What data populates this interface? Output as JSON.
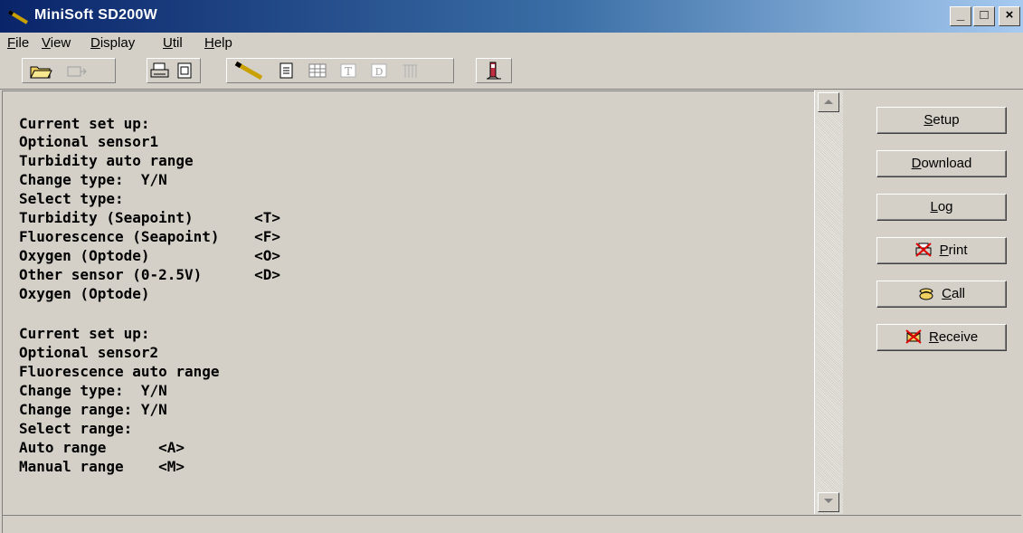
{
  "window": {
    "title": "MiniSoft SD200W",
    "controls": [
      "_",
      "□",
      "×"
    ]
  },
  "menu": [
    {
      "accel": "F",
      "rest": "ile"
    },
    {
      "accel": "V",
      "rest": "iew"
    },
    {
      "accel": "D",
      "rest": "isplay"
    },
    {
      "accel": "U",
      "rest": "til"
    },
    {
      "accel": "H",
      "rest": "elp"
    }
  ],
  "toolbar_icons": [
    "open-folder-icon",
    "import-icon",
    "print-icon",
    "page-icon",
    "pen-icon",
    "document-icon",
    "table-icon",
    "text-icon",
    "d-icon",
    "grid-icon",
    "instrument-icon"
  ],
  "terminal_lines": [
    "",
    "Current set up:",
    "Optional sensor1",
    "Turbidity auto range",
    "Change type:  Y/N",
    "Select type:",
    "Turbidity (Seapoint)       <T>",
    "Fluorescence (Seapoint)    <F>",
    "Oxygen (Optode)            <O>",
    "Other sensor (0-2.5V)      <D>",
    "Oxygen (Optode)",
    "",
    "Current set up:",
    "Optional sensor2",
    "Fluorescence auto range",
    "Change type:  Y/N",
    "Change range: Y/N",
    "Select range:",
    "Auto range      <A>",
    "Manual range    <M>"
  ],
  "side_buttons": [
    {
      "accel": "S",
      "rest": "etup",
      "icon": ""
    },
    {
      "accel": "D",
      "rest": "ownload",
      "icon": ""
    },
    {
      "accel": "L",
      "rest": "og",
      "icon": ""
    },
    {
      "accel": "P",
      "rest": "rint",
      "icon": "print-disabled-icon"
    },
    {
      "accel": "C",
      "rest": "all",
      "icon": "phone-icon"
    },
    {
      "accel": "R",
      "rest": "eceive",
      "icon": "receive-disabled-icon"
    }
  ],
  "status_text": "",
  "colors": {
    "title_start": "#0a246a",
    "title_end": "#a6caf0",
    "face": "#d4d0c8"
  }
}
